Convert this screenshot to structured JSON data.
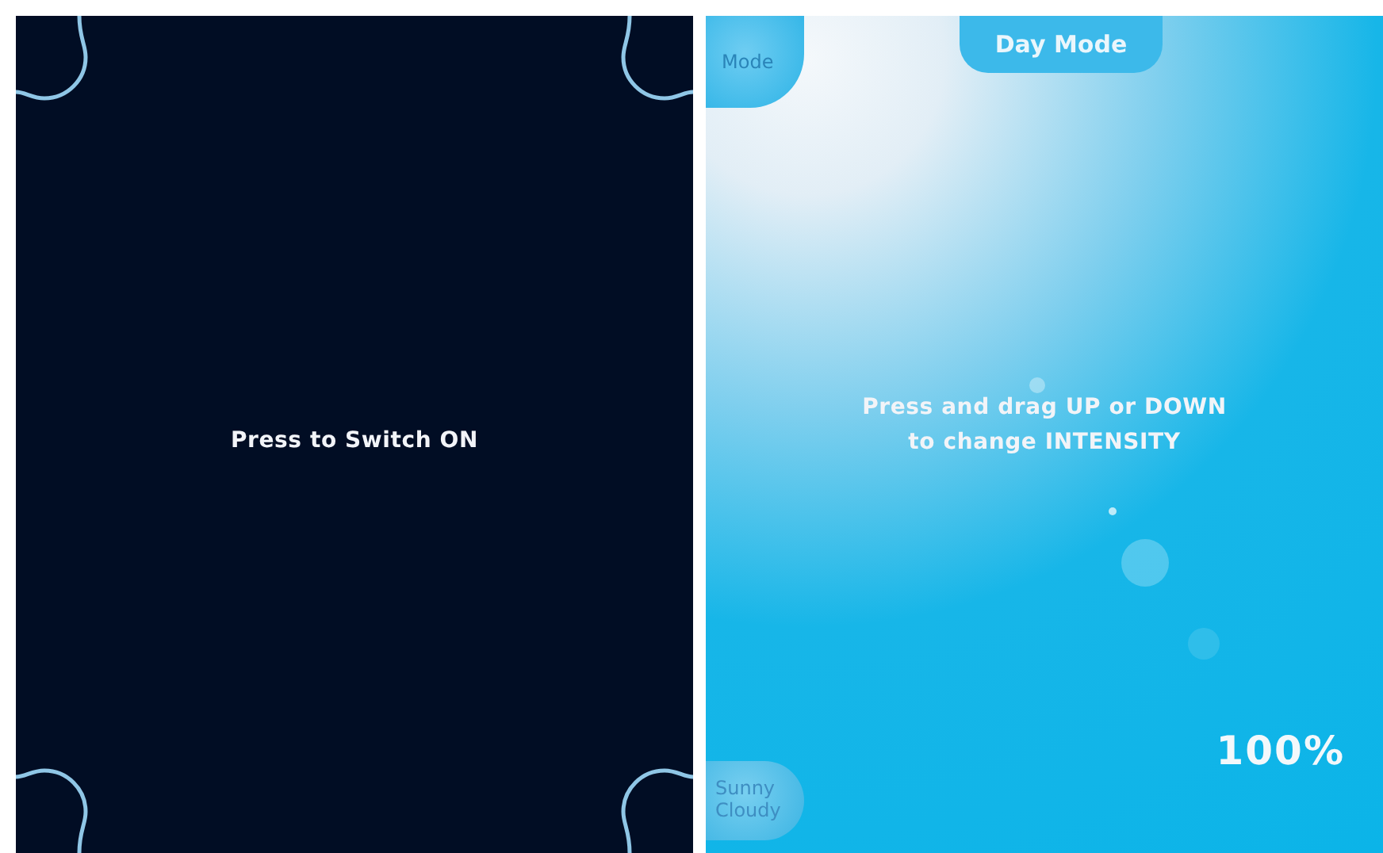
{
  "screens": [
    {
      "kind": "off",
      "message": "Press to Switch ON"
    },
    {
      "kind": "on",
      "mode_button": "Mode",
      "mode_title": "Day Mode",
      "instruction": [
        "Press and drag UP or DOWN",
        "to change INTENSITY"
      ],
      "intensity": "100%",
      "weather_button": [
        "Sunny",
        "Cloudy"
      ]
    }
  ]
}
